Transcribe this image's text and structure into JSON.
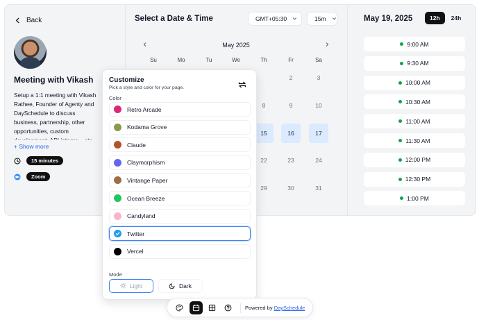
{
  "left": {
    "back_label": "Back",
    "title": "Meeting with Vikash",
    "description": "Setup a 1:1 meeting with Vikash Rathee, Founder of Agenty and DaySchedule to discuss business, partnership, other opportunities, custom development, API integra... etc.",
    "show_more": "+ Show more",
    "duration": "15 minutes",
    "location": "Zoom"
  },
  "center": {
    "heading": "Select a Date & Time",
    "timezone": "GMT+05:30",
    "interval": "15m",
    "month": "May 2025",
    "weekdays": [
      "Su",
      "Mo",
      "Tu",
      "We",
      "Th",
      "Fr",
      "Sa"
    ],
    "visible_days": {
      "row1": [
        "2",
        "3"
      ],
      "row2": [
        "8",
        "9",
        "10"
      ],
      "row3": [
        "15",
        "16",
        "17"
      ],
      "row4": [
        "22",
        "23",
        "24"
      ],
      "row5": [
        "29",
        "30",
        "31"
      ]
    }
  },
  "right": {
    "date": "May 19, 2025",
    "format_12h": "12h",
    "format_24h": "24h",
    "slots": [
      "9:00 AM",
      "9:30 AM",
      "10:00 AM",
      "10:30 AM",
      "11:00 AM",
      "11:30 AM",
      "12:00 PM",
      "12:30 PM",
      "1:00 PM"
    ],
    "slot_color": "#16a34a"
  },
  "customize": {
    "title": "Customize",
    "subtitle": "Pick a style and color for your page.",
    "color_label": "Color",
    "themes": [
      {
        "name": "Retro Arcade",
        "color": "#db2777"
      },
      {
        "name": "Kodama Grove",
        "color": "#8a9a4a"
      },
      {
        "name": "Claude",
        "color": "#b4532a"
      },
      {
        "name": "Claymorphism",
        "color": "#6366f1"
      },
      {
        "name": "Vintange Paper",
        "color": "#a16c43"
      },
      {
        "name": "Ocean Breeze",
        "color": "#22c55e"
      },
      {
        "name": "Candyland",
        "color": "#f9b4c8"
      },
      {
        "name": "Twitter",
        "color": "#1d9bf0"
      },
      {
        "name": "Vercel",
        "color": "#000000"
      }
    ],
    "selected_theme": "Twitter",
    "mode_label": "Mode",
    "mode_light": "Light",
    "mode_dark": "Dark",
    "selected_mode": "Light"
  },
  "bottom_bar": {
    "powered_by": "Powered by",
    "brand": "DaySchedule"
  },
  "accent": "#3b82f6"
}
